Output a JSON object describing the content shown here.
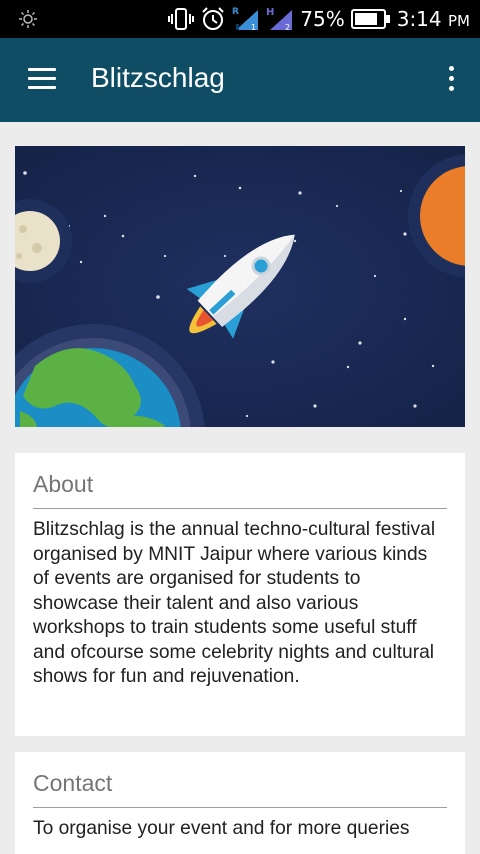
{
  "status_bar": {
    "battery": "75%",
    "time": "3:14",
    "ampm": "PM",
    "icons": [
      "brightness-icon",
      "vibrate-icon",
      "alarm-icon",
      "signal-roaming-icon",
      "signal-h-icon",
      "battery-icon"
    ]
  },
  "app_bar": {
    "title": "Blitzschlag",
    "color": "#0e4d64"
  },
  "banner": {
    "icon": "rocket-space-illustration"
  },
  "about": {
    "title": "About",
    "body": "Blitzschlag is the annual techno-cultural festival organised by MNIT Jaipur where various kinds of events are organised for students to showcase their talent and also various workshops to train students some useful stuff and ofcourse some celebrity nights and cultural shows for fun and rejuvenation."
  },
  "contact": {
    "title": "Contact",
    "body": "To organise your event and for more queries"
  }
}
